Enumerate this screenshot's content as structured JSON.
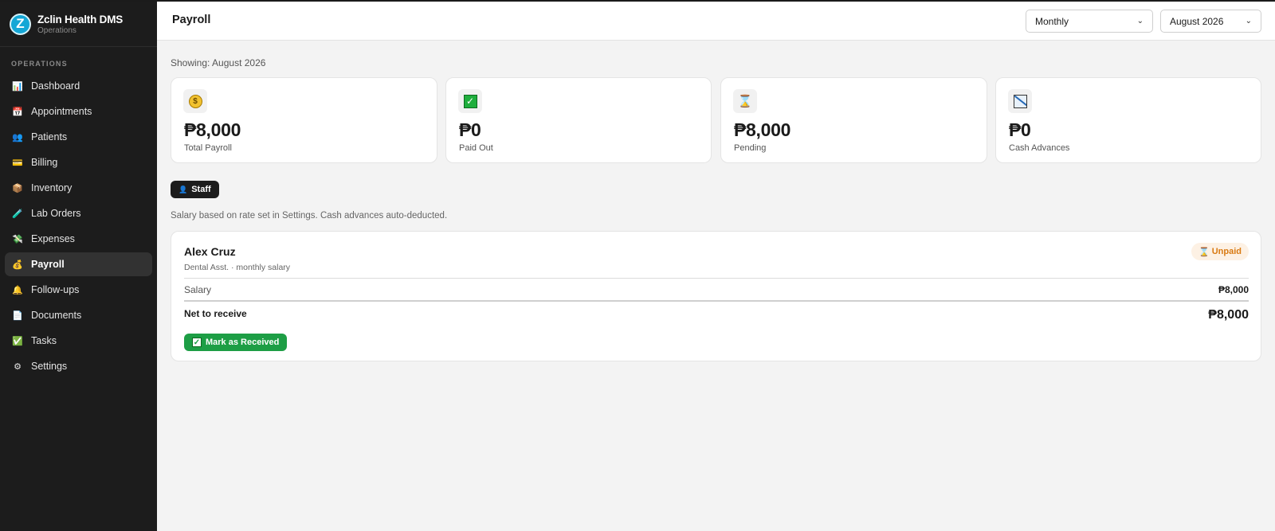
{
  "brand": {
    "name": "Zclin Health DMS",
    "subtitle": "Operations",
    "logo_letter": "Z"
  },
  "sidebar": {
    "section_label": "OPERATIONS",
    "items": [
      {
        "label": "Dashboard",
        "icon": "bar-chart-icon",
        "glyph": "📊",
        "active": false
      },
      {
        "label": "Appointments",
        "icon": "calendar-icon",
        "glyph": "📅",
        "active": false
      },
      {
        "label": "Patients",
        "icon": "people-icon",
        "glyph": "👥",
        "active": false
      },
      {
        "label": "Billing",
        "icon": "credit-card-icon",
        "glyph": "💳",
        "active": false
      },
      {
        "label": "Inventory",
        "icon": "box-icon",
        "glyph": "📦",
        "active": false
      },
      {
        "label": "Lab Orders",
        "icon": "test-tube-icon",
        "glyph": "🧪",
        "active": false
      },
      {
        "label": "Expenses",
        "icon": "money-wings-icon",
        "glyph": "💸",
        "active": false
      },
      {
        "label": "Payroll",
        "icon": "money-bag-icon",
        "glyph": "💰",
        "active": true
      },
      {
        "label": "Follow-ups",
        "icon": "bell-icon",
        "glyph": "🔔",
        "active": false
      },
      {
        "label": "Documents",
        "icon": "document-icon",
        "glyph": "📄",
        "active": false
      },
      {
        "label": "Tasks",
        "icon": "check-box-icon",
        "glyph": "✅",
        "active": false
      },
      {
        "label": "Settings",
        "icon": "gear-icon",
        "glyph": "⚙",
        "active": false
      }
    ]
  },
  "header": {
    "title": "Payroll",
    "period_select": "Monthly",
    "month_select": "August 2026"
  },
  "main": {
    "showing": "Showing: August 2026",
    "stats": [
      {
        "value": "₱8,000",
        "label": "Total Payroll",
        "icon": "money-bag-icon"
      },
      {
        "value": "₱0",
        "label": "Paid Out",
        "icon": "check-box-icon"
      },
      {
        "value": "₱8,000",
        "label": "Pending",
        "icon": "hourglass-icon"
      },
      {
        "value": "₱0",
        "label": "Cash Advances",
        "icon": "chart-decreasing-icon"
      }
    ],
    "tab_label": "Staff",
    "note": "Salary based on rate set in Settings. Cash advances auto-deducted.",
    "staff": {
      "name": "Alex Cruz",
      "role": "Dental Asst. · monthly salary",
      "status": "Unpaid",
      "salary_label": "Salary",
      "salary_value": "₱8,000",
      "net_label": "Net to receive",
      "net_value": "₱8,000",
      "action_label": "Mark as Received"
    }
  },
  "colors": {
    "sidebar_bg": "#1c1c1c",
    "accent_green": "#1d9e45",
    "unpaid_orange": "#d97a12",
    "brand_blue": "#14a7d6"
  }
}
